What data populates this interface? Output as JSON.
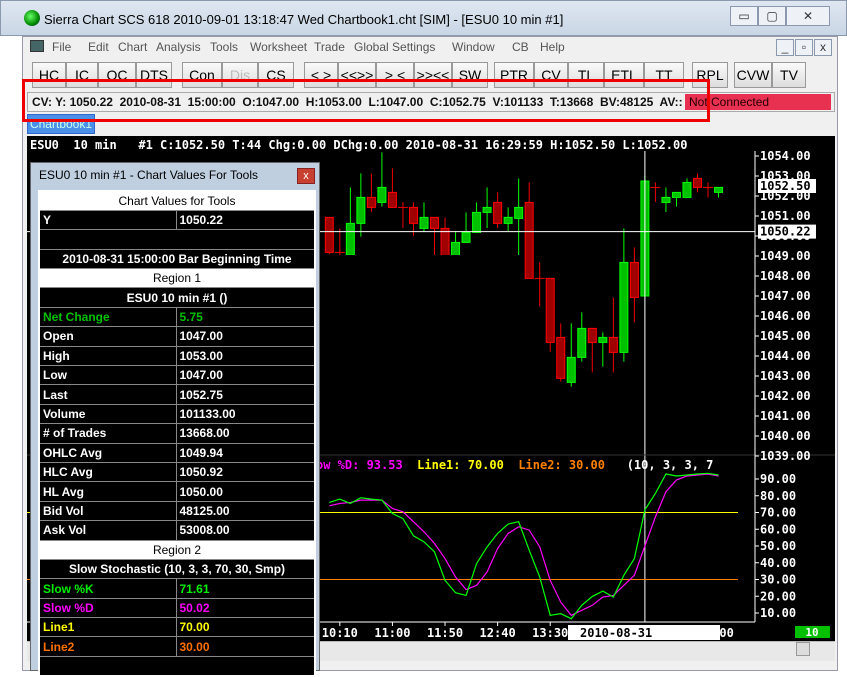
{
  "window": {
    "title": "Sierra Chart SCS 618  2010-09-01  13:18:47  Wed   Chartbook1.cht [SIM] - [ESU0  10 min   #1]",
    "controls": [
      "▭",
      "▢",
      "✕"
    ]
  },
  "mdi_controls": [
    "_",
    "▫",
    "x"
  ],
  "menu": [
    "File",
    "Edit",
    "Chart",
    "Analysis",
    "Tools",
    "Worksheet",
    "Trade",
    "Global Settings",
    "Window",
    "CB",
    "Help"
  ],
  "toolbar": [
    "HC",
    "IC",
    "OC",
    "DTS",
    "Con",
    "Dis",
    "CS",
    "< >",
    "<<>>",
    "> <",
    ">><<",
    "SW",
    "PTR",
    "CV",
    "TL",
    "ETL",
    "TT",
    "RPL",
    "CVW",
    "TV"
  ],
  "cv_bar": {
    "text": "CV: Y: 1050.22  2010-08-31  15:00:00  O:1047.00  H:1053.00  L:1047.00  C:1052.75  V:101133  T:13668  BV:48125  AV::",
    "status": "Not Connected",
    "status_color": "#e83050"
  },
  "tab": "Chartbook1",
  "chart_header": "ESU0  10 min   #1 C:1052.50 T:44 Chg:0.00 DChg:0.00 2010-08-31 16:29:59 H:1052.50 L:1052.00",
  "stoch_header": {
    "d": "ow %D: 93.53",
    "line1": "Line1: 70.00",
    "line2": "Line2: 30.00",
    "params": "(10, 3, 3, 7"
  },
  "price_axis": {
    "labels": [
      "1054.00",
      "1053.00",
      "1052.00",
      "1051.00",
      "1050.00",
      "1049.00",
      "1048.00",
      "1047.00",
      "1046.00",
      "1045.00",
      "1044.00",
      "1043.00",
      "1042.00",
      "1041.00",
      "1040.00",
      "1039.00"
    ],
    "last_price": "1052.50",
    "cursor_price": "1050.22"
  },
  "stoch_axis": {
    "labels": [
      "90.00",
      "80.00",
      "70.00",
      "60.00",
      "50.00",
      "40.00",
      "30.00",
      "20.00",
      "10.00"
    ]
  },
  "time_axis": {
    "labels": [
      {
        "i": 1,
        "t": "10:10"
      },
      {
        "i": 6,
        "t": "11:00"
      },
      {
        "i": 11,
        "t": "11:50"
      },
      {
        "i": 16,
        "t": "12:40"
      },
      {
        "i": 21,
        "t": "13:30"
      }
    ],
    "cursor_date": "2010-08-31",
    "cursor_time": "15:00:00",
    "bar_spacing_badge": "10"
  },
  "colors": {
    "up": "#00c000",
    "down": "#a00000",
    "k": "#00ff00",
    "d": "#ff00ff",
    "line1": "#ffff00",
    "line2": "#ff8000"
  },
  "chart_data": {
    "type": "candlestick",
    "cursor_index": 30,
    "ohlc": [
      [
        1050.93,
        1050.93,
        1049.1,
        1049.18
      ],
      [
        1049.18,
        1050.38,
        1047.72,
        1049.18
      ],
      [
        1049.05,
        1052.43,
        1049.05,
        1050.63
      ],
      [
        1050.63,
        1053.13,
        1049.97,
        1051.93
      ],
      [
        1051.93,
        1053.13,
        1051.2,
        1051.43
      ],
      [
        1051.68,
        1054.18,
        1051.47,
        1052.43
      ],
      [
        1052.18,
        1053.38,
        1051.43,
        1051.43
      ],
      [
        1051.43,
        1051.7,
        1050.4,
        1051.43
      ],
      [
        1051.43,
        1051.68,
        1050.0,
        1050.63
      ],
      [
        1050.38,
        1051.68,
        1050.2,
        1050.93
      ],
      [
        1050.93,
        1050.93,
        1049.05,
        1050.38
      ],
      [
        1050.38,
        1050.93,
        1048.3,
        1048.4
      ],
      [
        1048.4,
        1050.2,
        1047.9,
        1049.68
      ],
      [
        1049.68,
        1051.18,
        1049.68,
        1050.18
      ],
      [
        1050.18,
        1051.68,
        1050.18,
        1051.18
      ],
      [
        1051.18,
        1052.43,
        1050.4,
        1051.43
      ],
      [
        1051.68,
        1052.18,
        1050.4,
        1050.63
      ],
      [
        1050.63,
        1051.43,
        1050.2,
        1050.93
      ],
      [
        1050.88,
        1052.88,
        1049.05,
        1051.43
      ],
      [
        1051.68,
        1052.68,
        1047.88,
        1047.88
      ],
      [
        1047.88,
        1048.68,
        1046.47,
        1047.88
      ],
      [
        1047.88,
        1047.88,
        1044.22,
        1044.68
      ],
      [
        1044.93,
        1045.63,
        1042.72,
        1042.88
      ],
      [
        1042.68,
        1045.63,
        1042.47,
        1043.93
      ],
      [
        1043.93,
        1046.18,
        1043.72,
        1045.38
      ],
      [
        1045.38,
        1045.38,
        1043.18,
        1044.68
      ],
      [
        1044.68,
        1045.18,
        1043.47,
        1044.93
      ],
      [
        1044.93,
        1046.93,
        1043.18,
        1044.18
      ],
      [
        1044.18,
        1050.38,
        1043.72,
        1048.68
      ],
      [
        1048.68,
        1049.43,
        1045.67,
        1046.93
      ],
      [
        1047.0,
        1053.0,
        1047.0,
        1052.75
      ],
      [
        1052.43,
        1052.68,
        1051.7,
        1052.43
      ],
      [
        1051.68,
        1052.43,
        1051.2,
        1051.93
      ],
      [
        1051.93,
        1052.18,
        1051.47,
        1052.18
      ],
      [
        1051.93,
        1052.88,
        1051.93,
        1052.68
      ],
      [
        1052.88,
        1053.13,
        1052.18,
        1052.43
      ],
      [
        1052.43,
        1052.68,
        1051.93,
        1052.43
      ],
      [
        1052.18,
        1052.43,
        1051.93,
        1052.43
      ]
    ],
    "slow_k": [
      76,
      78.0,
      75.4,
      78.8,
      78.0,
      77.4,
      69.4,
      66.4,
      56.1,
      52.5,
      46.5,
      29.5,
      22.1,
      20.5,
      39.5,
      49.5,
      57.5,
      63.1,
      64.5,
      47.5,
      31.5,
      8.6,
      9.6,
      6.6,
      14.6,
      19.9,
      23.1,
      19.5,
      32.5,
      42.5,
      71.61,
      81.4,
      93.0,
      91.8,
      92.4,
      93.0,
      93.4,
      92.4
    ],
    "slow_d": [
      74,
      75.4,
      76.0,
      77.4,
      77.4,
      77.4,
      72.4,
      70.4,
      64.5,
      58.5,
      51.5,
      42.5,
      31.5,
      24.0,
      26.5,
      34.5,
      48.5,
      57.5,
      61.5,
      59.5,
      49.5,
      29.5,
      16.5,
      8.6,
      11.6,
      14.6,
      19.5,
      20.5,
      26.5,
      32.5,
      50.02,
      67.4,
      82.4,
      89.4,
      91.8,
      92.4,
      93.0,
      91.8
    ],
    "line1": 70,
    "line2": 30,
    "price_range": [
      1039,
      1054
    ],
    "stoch_range": [
      10,
      90
    ]
  },
  "dialog": {
    "title": "ESU0  10 min   #1 - Chart Values For Tools",
    "close": "x",
    "rows": [
      {
        "type": "head",
        "a": "Chart Values for Tools"
      },
      {
        "a": "Y",
        "b": "1050.22"
      },
      {
        "type": "blank"
      },
      {
        "type": "center",
        "a": "2010-08-31  15:00:00  Bar Beginning Time"
      },
      {
        "type": "head",
        "a": "Region 1"
      },
      {
        "type": "center",
        "a": "ESU0  10 min   #1 ()"
      },
      {
        "a": "Net Change",
        "b": "5.75",
        "color": "#00c000"
      },
      {
        "a": "Open",
        "b": "1047.00"
      },
      {
        "a": "High",
        "b": "1053.00"
      },
      {
        "a": "Low",
        "b": "1047.00"
      },
      {
        "a": "Last",
        "b": "1052.75"
      },
      {
        "a": "Volume",
        "b": "101133.00"
      },
      {
        "a": "# of Trades",
        "b": "13668.00"
      },
      {
        "a": "OHLC Avg",
        "b": "1049.94"
      },
      {
        "a": "HLC Avg",
        "b": "1050.92"
      },
      {
        "a": "HL Avg",
        "b": "1050.00"
      },
      {
        "a": "Bid Vol",
        "b": "48125.00"
      },
      {
        "a": "Ask Vol",
        "b": "53008.00"
      },
      {
        "type": "head",
        "a": "Region 2"
      },
      {
        "type": "center",
        "a": "Slow Stochastic (10, 3, 3, 70, 30, Smp)"
      },
      {
        "a": "Slow %K",
        "b": "71.61",
        "color": "#00ee00"
      },
      {
        "a": "Slow %D",
        "b": "50.02",
        "color": "#ff00ff"
      },
      {
        "a": "Line1",
        "b": "70.00",
        "color": "#ffff00"
      },
      {
        "a": "Line2",
        "b": "30.00",
        "color": "#ff7000"
      },
      {
        "type": "blank"
      }
    ]
  }
}
